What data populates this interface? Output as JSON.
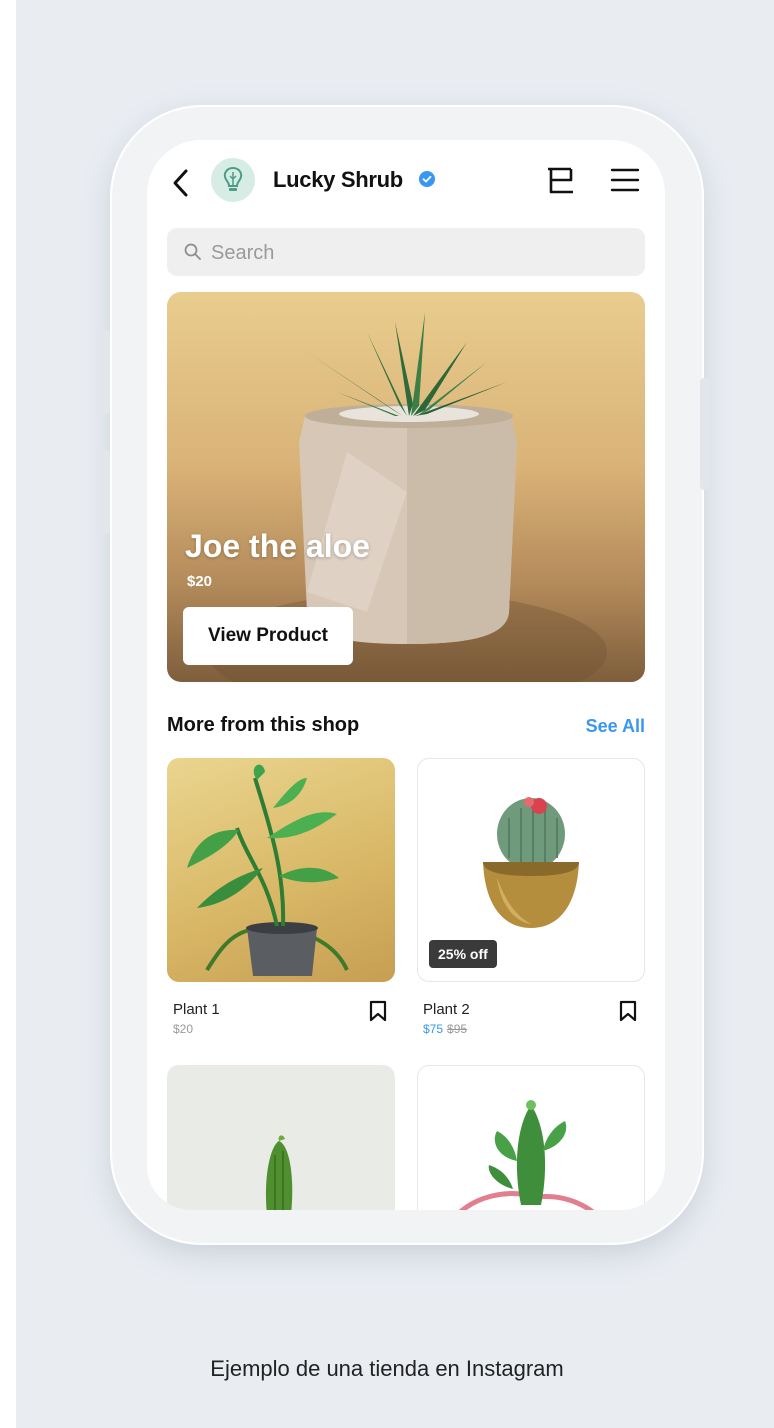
{
  "header": {
    "shop_name": "Lucky Shrub",
    "back_icon": "chevron-left-icon",
    "verified_icon": "verified-badge-icon",
    "cart_icon": "cart-icon",
    "menu_icon": "hamburger-menu-icon"
  },
  "search": {
    "placeholder": "Search",
    "icon": "search-icon"
  },
  "hero": {
    "title": "Joe the aloe",
    "price": "$20",
    "button_label": "View Product"
  },
  "section": {
    "title": "More from this shop",
    "see_all": "See All"
  },
  "products": [
    {
      "name": "Plant 1",
      "price": "$20",
      "badge": "",
      "sale_price": "",
      "original_price": ""
    },
    {
      "name": "Plant 2",
      "price": "",
      "badge": "25% off",
      "sale_price": "$75",
      "original_price": "$95"
    },
    {
      "name": "",
      "price": ""
    },
    {
      "name": "",
      "price": ""
    }
  ],
  "caption": "Ejemplo de una tienda en Instagram",
  "colors": {
    "accent": "#3897f0",
    "background": "#e9edf2",
    "hero_gold": "#d9b277"
  }
}
